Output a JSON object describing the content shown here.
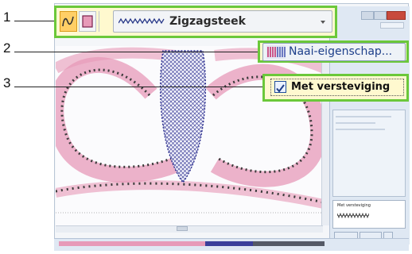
{
  "callouts": [
    "1",
    "2",
    "3"
  ],
  "toolbar": {
    "tool_line_icon": "line-sew-icon",
    "tool_region_icon": "region-sew-icon",
    "stitch_type": "Zigzagsteek",
    "stitch_type_icon": "zigzag-wave-icon",
    "dropdown_icon": "chevron-down-icon"
  },
  "sew_properties_button": {
    "label": "Naai-eigenschap...",
    "icon": "stitch-pattern-icon"
  },
  "underlay_checkbox": {
    "label": "Met versteviging",
    "checked": true,
    "icon": "checkmark-icon"
  },
  "preview_panel": {
    "label": "Met versteviging"
  },
  "colors": {
    "highlight_border": "#6bc83a",
    "highlight_fill": "#fff9cf",
    "selected_tool": "#ffcf66",
    "stitch_pink": "#e79ab8",
    "stitch_blue": "#2a2d8e",
    "stitch_dots": "#3b3b3b"
  }
}
